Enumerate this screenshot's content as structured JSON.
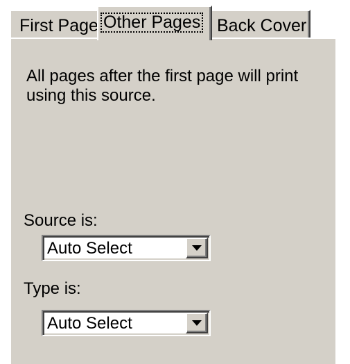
{
  "tabs": [
    {
      "label": "First Page",
      "active": false
    },
    {
      "label": "Other Pages",
      "active": true
    },
    {
      "label": "Back Cover",
      "active": false
    }
  ],
  "description": "All pages after the first page will print using this source.",
  "source": {
    "label": "Source is:",
    "value": "Auto Select"
  },
  "type": {
    "label": "Type is:",
    "value": "Auto Select"
  },
  "icons": {
    "dropdown": "chevron-down-icon"
  },
  "colors": {
    "face": "#d4d0c8",
    "highlight": "#ffffff",
    "shadow": "#808080",
    "dark_shadow": "#404040"
  }
}
